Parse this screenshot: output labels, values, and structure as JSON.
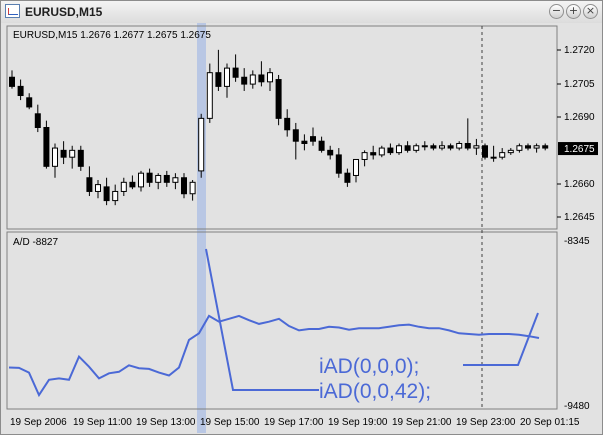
{
  "window": {
    "title": "EURUSD,M15",
    "buttons": {
      "minimize": "−",
      "maximize": "+",
      "close": "×"
    }
  },
  "price_panel": {
    "header": "EURUSD,M15  1.2676 1.2677 1.2675 1.2675",
    "axis_labels": [
      "1.2720",
      "1.2705",
      "1.2690",
      "1.2675",
      "1.2660",
      "1.2645"
    ],
    "current_price": "1.2675",
    "current_price_value": 1.2675
  },
  "indicator_panel": {
    "header": "A/D -8827",
    "axis_top": "-8345",
    "axis_bottom": "-9480"
  },
  "annotations": {
    "line1": "iAD(0,0,0);",
    "line2": "iAD(0,0,42);"
  },
  "time_axis": [
    "19 Sep 2006",
    "19 Sep 11:00",
    "19 Sep 13:00",
    "19 Sep 15:00",
    "19 Sep 17:00",
    "19 Sep 19:00",
    "19 Sep 21:00",
    "19 Sep 23:00",
    "20 Sep 01:15"
  ],
  "colors": {
    "chart_bg": "#e2e2e2",
    "line": "#4b69d6",
    "annotation": "#4b69d6",
    "highlight": "#a8bce6",
    "candle_bull": "#ffffff",
    "candle_bear": "#000000",
    "price_tag_bg": "#000000"
  },
  "chart_data": [
    {
      "type": "candlestick",
      "series": [
        {
          "values": [
            [
              1.2706,
              1.2709,
              1.2701,
              1.2702
            ],
            [
              1.2702,
              1.2705,
              1.2696,
              1.2698
            ],
            [
              1.2697,
              1.2699,
              1.2692,
              1.2693
            ],
            [
              1.269,
              1.2694,
              1.2682,
              1.2684
            ],
            [
              1.2684,
              1.2687,
              1.2666,
              1.2667
            ],
            [
              1.2667,
              1.2677,
              1.2662,
              1.2675
            ],
            [
              1.2674,
              1.2678,
              1.2668,
              1.2671
            ],
            [
              1.2671,
              1.2676,
              1.2666,
              1.2674
            ],
            [
              1.2674,
              1.2676,
              1.2665,
              1.2667
            ],
            [
              1.2662,
              1.2667,
              1.2654,
              1.2656
            ],
            [
              1.2656,
              1.2661,
              1.2653,
              1.2659
            ],
            [
              1.2658,
              1.2662,
              1.265,
              1.2652
            ],
            [
              1.2652,
              1.2659,
              1.265,
              1.2656
            ],
            [
              1.2656,
              1.2662,
              1.2654,
              1.266
            ],
            [
              1.266,
              1.2663,
              1.2657,
              1.2658
            ],
            [
              1.2658,
              1.2665,
              1.2656,
              1.2664
            ],
            [
              1.2664,
              1.2666,
              1.2658,
              1.266
            ],
            [
              1.266,
              1.2664,
              1.2657,
              1.2663
            ],
            [
              1.2663,
              1.2665,
              1.2658,
              1.266
            ],
            [
              1.266,
              1.2664,
              1.2657,
              1.2662
            ],
            [
              1.2662,
              1.2664,
              1.2653,
              1.2655
            ],
            [
              1.2655,
              1.2661,
              1.2652,
              1.266
            ],
            [
              1.2665,
              1.269,
              1.2662,
              1.2688
            ],
            [
              1.2688,
              1.2712,
              1.2686,
              1.2708
            ],
            [
              1.2708,
              1.2718,
              1.27,
              1.2702
            ],
            [
              1.2702,
              1.2712,
              1.2697,
              1.271
            ],
            [
              1.271,
              1.2716,
              1.2704,
              1.2706
            ],
            [
              1.2706,
              1.271,
              1.27,
              1.2703
            ],
            [
              1.2703,
              1.2709,
              1.2701,
              1.2707
            ],
            [
              1.2707,
              1.2713,
              1.2702,
              1.2704
            ],
            [
              1.2704,
              1.271,
              1.27,
              1.2708
            ],
            [
              1.2705,
              1.2707,
              1.2685,
              1.2688
            ],
            [
              1.2688,
              1.2692,
              1.268,
              1.2683
            ],
            [
              1.2683,
              1.2686,
              1.267,
              1.2678
            ],
            [
              1.2678,
              1.2681,
              1.2674,
              1.2677
            ],
            [
              1.268,
              1.2684,
              1.2676,
              1.2678
            ],
            [
              1.2678,
              1.268,
              1.2673,
              1.2674
            ],
            [
              1.2674,
              1.2676,
              1.267,
              1.2672
            ],
            [
              1.2672,
              1.2675,
              1.2662,
              1.2664
            ],
            [
              1.2664,
              1.2666,
              1.2658,
              1.266
            ],
            [
              1.2663,
              1.267,
              1.266,
              1.267
            ],
            [
              1.267,
              1.2674,
              1.2667,
              1.2673
            ],
            [
              1.2673,
              1.2676,
              1.267,
              1.2672
            ],
            [
              1.2672,
              1.2676,
              1.2671,
              1.2675
            ],
            [
              1.2675,
              1.2677,
              1.2672,
              1.2673
            ],
            [
              1.2673,
              1.2677,
              1.2672,
              1.2676
            ],
            [
              1.2676,
              1.2678,
              1.2673,
              1.2674
            ],
            [
              1.2674,
              1.2677,
              1.2673,
              1.2676
            ],
            [
              1.2676,
              1.2678,
              1.2674,
              1.2676
            ],
            [
              1.2676,
              1.2677,
              1.2674,
              1.2675
            ],
            [
              1.2675,
              1.2678,
              1.2674,
              1.2676
            ],
            [
              1.2676,
              1.2677,
              1.2674,
              1.2675
            ],
            [
              1.2675,
              1.2678,
              1.2674,
              1.2677
            ],
            [
              1.2677,
              1.2688,
              1.2674,
              1.2675
            ],
            [
              1.2675,
              1.2679,
              1.2672,
              1.2676
            ],
            [
              1.2676,
              1.2677,
              1.267,
              1.2671
            ],
            [
              1.2671,
              1.2676,
              1.2669,
              1.2671
            ],
            [
              1.2671,
              1.2675,
              1.267,
              1.2673
            ],
            [
              1.2673,
              1.2675,
              1.2672,
              1.2674
            ],
            [
              1.2674,
              1.2677,
              1.2673,
              1.2676
            ],
            [
              1.2676,
              1.2677,
              1.2674,
              1.2675
            ],
            [
              1.2675,
              1.2677,
              1.2673,
              1.2676
            ],
            [
              1.2676,
              1.2677,
              1.2674,
              1.2675
            ]
          ]
        }
      ],
      "ylim": [
        1.264,
        1.2728
      ]
    },
    {
      "type": "line",
      "title": "A/D -8827",
      "ylim": [
        -9480,
        -8345
      ],
      "series": [
        {
          "values": [
            -9215,
            -9218,
            -9250,
            -9405,
            -9300,
            -9290,
            -9300,
            -9140,
            -9210,
            -9290,
            -9255,
            -9245,
            -9200,
            -9220,
            -9225,
            -9250,
            -9270,
            -9215,
            -9025,
            -8980,
            -8860,
            -8900,
            -8880,
            -8860,
            -8890,
            -8915,
            -8900,
            -8880,
            -8930,
            -8960,
            -8950,
            -8950,
            -8935,
            -8940,
            -8955,
            -8945,
            -8945,
            -8945,
            -8935,
            -8925,
            -8920,
            -8935,
            -8945,
            -8945,
            -8960,
            -8980,
            -8985,
            -8990,
            -8985,
            -8985,
            -8985,
            -8990,
            -9000,
            -9012
          ]
        }
      ]
    }
  ]
}
